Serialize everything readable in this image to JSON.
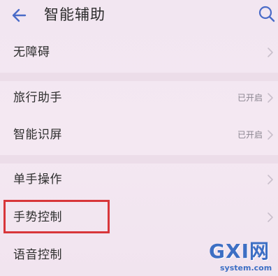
{
  "header": {
    "title": "智能辅助",
    "back_icon": "back-arrow-icon",
    "search_icon": "search-icon"
  },
  "settings": {
    "items": [
      {
        "label": "无障碍",
        "status": ""
      },
      {
        "label": "旅行助手",
        "status": "已开启"
      },
      {
        "label": "智能识屏",
        "status": "已开启"
      },
      {
        "label": "单手操作",
        "status": ""
      },
      {
        "label": "手势控制",
        "status": ""
      },
      {
        "label": "语音控制",
        "status": ""
      }
    ]
  },
  "highlight": {
    "target": "手势控制",
    "color": "#d8363a"
  },
  "watermark": {
    "main": "GXI网",
    "sub": "system.com"
  },
  "colors": {
    "background": "#f3e7f1",
    "accent": "#4a6bc8",
    "status_text": "#8a8590"
  }
}
